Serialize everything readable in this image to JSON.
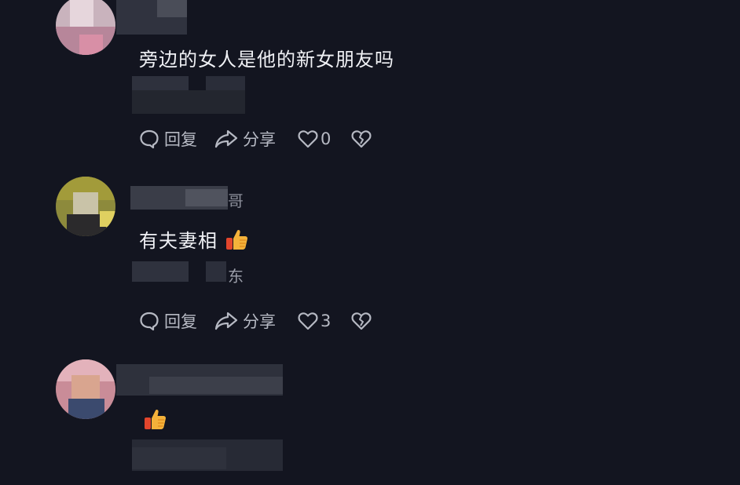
{
  "comments": [
    {
      "text": "旁边的女人是他的新女朋友吗",
      "name_tail": "",
      "location_tail": "",
      "reply_label": "回复",
      "share_label": "分享",
      "like_count": "0"
    },
    {
      "text": "有夫妻相",
      "emoji": "thumbs-up",
      "name_tail": "哥",
      "location_tail": "东",
      "reply_label": "回复",
      "share_label": "分享",
      "like_count": "3"
    },
    {
      "text": "",
      "emoji": "thumbs-up",
      "name_tail": "",
      "location_tail": ""
    }
  ],
  "colors": {
    "background": "#131520",
    "text": "#f0f1f5",
    "action": "#b6b9c3"
  },
  "icons": [
    "reply-icon",
    "share-icon",
    "like-heart-icon",
    "dislike-broken-heart-icon",
    "thumbs-up-emoji"
  ]
}
